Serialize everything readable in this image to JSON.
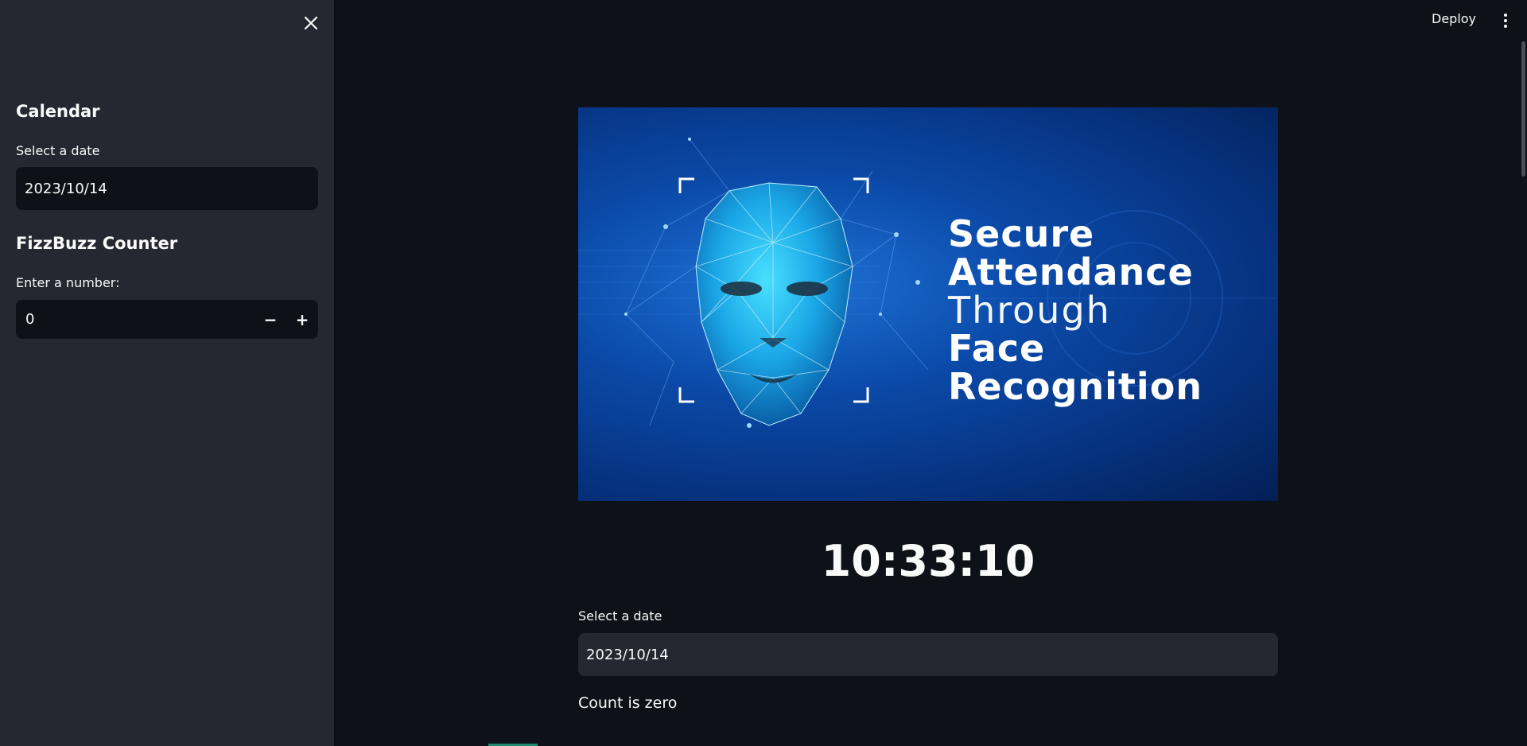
{
  "sidebar": {
    "calendar_heading": "Calendar",
    "date_label": "Select a date",
    "date_value": "2023/10/14",
    "fizzbuzz_heading": "FizzBuzz Counter",
    "number_label": "Enter a number:",
    "number_value": "0",
    "decrement_label": "−",
    "increment_label": "+"
  },
  "header": {
    "deploy_label": "Deploy"
  },
  "banner": {
    "line1": "Secure",
    "line2": "Attendance",
    "line3": "Through",
    "line4": "Face",
    "line5": "Recognition"
  },
  "main": {
    "clock": "10:33:10",
    "date_label": "Select a date",
    "date_value": "2023/10/14",
    "count_text": "Count is zero"
  },
  "colors": {
    "app_bg": "#0e1117",
    "sidebar_bg": "#262730",
    "input_bg": "#262730",
    "banner_blue": "#0b4aa9"
  },
  "icons": {
    "close": "close-icon",
    "menu": "more-vertical-icon"
  }
}
